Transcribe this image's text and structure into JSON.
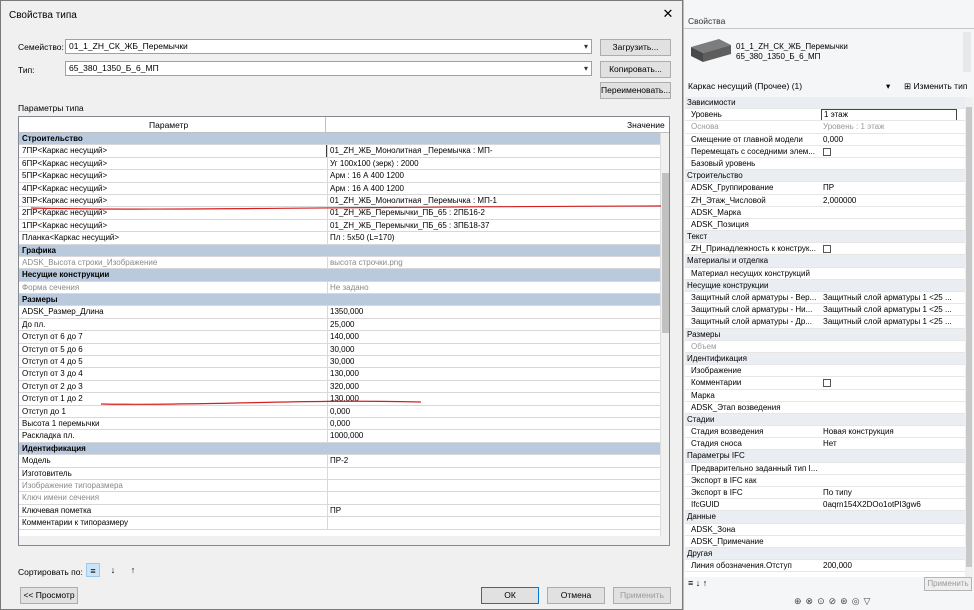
{
  "dialog": {
    "title": "Свойства типа",
    "close_glyph": "✕",
    "family_label": "Семейство:",
    "family_value": "01_1_ZH_СК_ЖБ_Перемычки",
    "type_label": "Тип:",
    "type_value": "65_380_1350_Б_6_МП",
    "load_button": "Загрузить...",
    "copy_button": "Копировать...",
    "rename_button": "Переименовать...",
    "params_section_label": "Параметры типа",
    "col_param": "Параметр",
    "col_value": "Значение",
    "sort_label": "Сортировать по:",
    "preview_button": "<< Просмотр",
    "ok_button": "ОК",
    "cancel_button": "Отмена",
    "apply_button": "Применить",
    "rows": [
      {
        "k": "Строительство",
        "cat": true
      },
      {
        "k": "7ПР<Каркас несущий>",
        "v": "01_ZH_ЖБ_Монолитная _Перемычка : МП-",
        "sel": true
      },
      {
        "k": "6ПР<Каркас несущий>",
        "v": "Уг 100х100 (зерк) : 2000"
      },
      {
        "k": "5ПР<Каркас несущий>",
        "v": "Арм : 16 А 400 1200"
      },
      {
        "k": "4ПР<Каркас несущий>",
        "v": "Арм : 16 А 400 1200"
      },
      {
        "k": "3ПР<Каркас несущий>",
        "v": "01_ZH_ЖБ_Монолитная _Перемычка : МП-1"
      },
      {
        "k": "2ПР<Каркас несущий>",
        "v": "01_ZH_ЖБ_Перемычки_ПБ_65 : 2ПБ16-2"
      },
      {
        "k": "1ПР<Каркас несущий>",
        "v": "01_ZH_ЖБ_Перемычки_ПБ_65 : 3ПБ18-37"
      },
      {
        "k": "Планка<Каркас несущий>",
        "v": "Пл : 5х50 (L=170)"
      },
      {
        "k": "Графика",
        "cat": true
      },
      {
        "k": "ADSK_Высота строки_Изображение",
        "v": "высота строчки.png",
        "gray": true
      },
      {
        "k": "Несущие конструкции",
        "cat": true
      },
      {
        "k": "Форма сечения",
        "v": "Не задано",
        "gray": true
      },
      {
        "k": "Размеры",
        "cat": true
      },
      {
        "k": "ADSK_Размер_Длина",
        "v": "1350,000"
      },
      {
        "k": "До пл.",
        "v": "25,000"
      },
      {
        "k": "Отступ от 6 до 7",
        "v": "140,000"
      },
      {
        "k": "Отступ от 5 до 6",
        "v": "30,000"
      },
      {
        "k": "Отступ от 4 до 5",
        "v": "30,000"
      },
      {
        "k": "Отступ от 3 до 4",
        "v": "130,000"
      },
      {
        "k": "Отступ от 2 до 3",
        "v": "320,000"
      },
      {
        "k": "Отступ от 1 до 2",
        "v": "130,000"
      },
      {
        "k": "Отступ до 1",
        "v": "0,000"
      },
      {
        "k": "Высота 1 перемычки",
        "v": "0,000"
      },
      {
        "k": "Раскладка пл.",
        "v": "1000,000"
      },
      {
        "k": "Идентификация",
        "cat": true
      },
      {
        "k": "Модель",
        "v": "ПР-2"
      },
      {
        "k": "Изготовитель",
        "v": ""
      },
      {
        "k": "Изображение типоразмера",
        "v": "",
        "gray": true
      },
      {
        "k": "Ключ имени сечения",
        "v": "",
        "gray": true
      },
      {
        "k": "Ключевая пометка",
        "v": "ПР"
      },
      {
        "k": "Комментарии к типоразмеру",
        "v": ""
      }
    ]
  },
  "props": {
    "title": "Свойства",
    "type_name_line1": "01_1_ZH_СК_ЖБ_Перемычки",
    "type_name_line2": "65_380_1350_Б_6_МП",
    "selector": "Каркас несущий (Прочее) (1)",
    "edit_type": "Изменить тип",
    "apply": "Применить",
    "rows": [
      {
        "k": "Зависимости",
        "cat": true
      },
      {
        "k": "Уровень",
        "v": "1 этаж",
        "sel": true
      },
      {
        "k": "Основа",
        "v": "Уровень : 1 этаж",
        "gray": true
      },
      {
        "k": "Смещение от главной модели",
        "v": "0,000"
      },
      {
        "k": "Перемещать с соседними элем...",
        "chk": true
      },
      {
        "k": "Базовый уровень",
        "v": ""
      },
      {
        "k": "Строительство",
        "cat": true
      },
      {
        "k": "ADSK_Группирование",
        "v": "ПР"
      },
      {
        "k": "ZH_Этаж_Числовой",
        "v": "2,000000"
      },
      {
        "k": "ADSK_Марка",
        "v": ""
      },
      {
        "k": "ADSK_Позиция",
        "v": ""
      },
      {
        "k": "Текст",
        "cat": true
      },
      {
        "k": "ZH_Принадлежность к конструк...",
        "chk": true
      },
      {
        "k": "Материалы и отделка",
        "cat": true
      },
      {
        "k": "Материал несущих конструкций",
        "v": ""
      },
      {
        "k": "Несущие конструкции",
        "cat": true
      },
      {
        "k": "Защитный слой арматуры - Вер...",
        "v": "Защитный слой арматуры 1 <25 ..."
      },
      {
        "k": "Защитный слой арматуры - Ни...",
        "v": "Защитный слой арматуры 1 <25 ..."
      },
      {
        "k": "Защитный слой арматуры - Др...",
        "v": "Защитный слой арматуры 1 <25 ..."
      },
      {
        "k": "Размеры",
        "cat": true
      },
      {
        "k": "Объем",
        "v": "",
        "gray": true
      },
      {
        "k": "Идентификация",
        "cat": true
      },
      {
        "k": "Изображение",
        "v": ""
      },
      {
        "k": "Комментарии",
        "chk": true
      },
      {
        "k": "Марка",
        "v": ""
      },
      {
        "k": "ADSK_Этап возведения",
        "v": ""
      },
      {
        "k": "Стадии",
        "cat": true
      },
      {
        "k": "Стадия возведения",
        "v": "Новая конструкция"
      },
      {
        "k": "Стадия сноса",
        "v": "Нет"
      },
      {
        "k": "Параметры IFC",
        "cat": true
      },
      {
        "k": "Предварительно заданный тип I...",
        "v": ""
      },
      {
        "k": "Экспорт в IFC как",
        "v": ""
      },
      {
        "k": "Экспорт в IFC",
        "v": "По типу"
      },
      {
        "k": "IfcGUID",
        "v": "0aqrn154X2DOo1otPI3gw6"
      },
      {
        "k": "Данные",
        "cat": true
      },
      {
        "k": "ADSK_Зона",
        "v": ""
      },
      {
        "k": "ADSK_Примечание",
        "v": ""
      },
      {
        "k": "Другая",
        "cat": true
      },
      {
        "k": "Линия обозначения.Отступ",
        "v": "200,000"
      }
    ]
  },
  "colors": {
    "category_bg": "#b9c9de",
    "red_annotation": "#d42020"
  }
}
